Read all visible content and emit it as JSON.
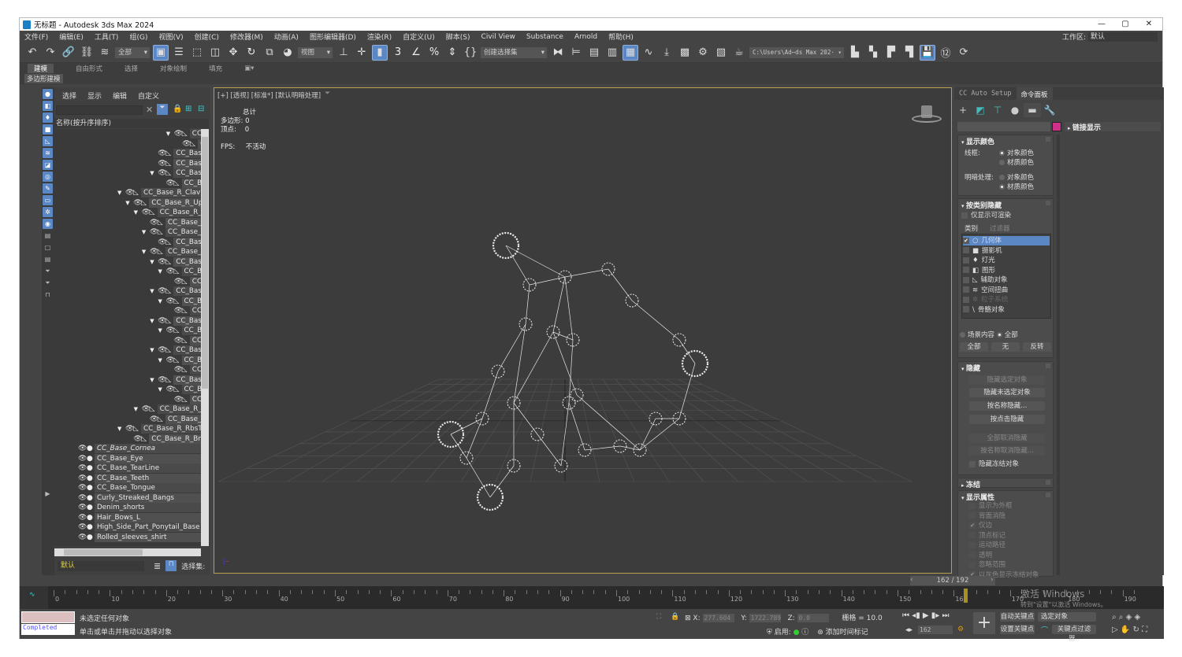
{
  "window": {
    "title": "无标题 - Autodesk 3ds Max 2024",
    "controls": [
      "—",
      "▢",
      "✕"
    ]
  },
  "menu": [
    "文件(F)",
    "编辑(E)",
    "工具(T)",
    "组(G)",
    "视图(V)",
    "创建(C)",
    "修改器(M)",
    "动画(A)",
    "图形编辑器(D)",
    "渲染(R)",
    "自定义(U)",
    "脚本(S)",
    "Civil View",
    "Substance",
    "Arnold",
    "帮助(H)"
  ],
  "workspace": {
    "label": "工作区:",
    "value": "默认"
  },
  "toolbar": {
    "selection_filter": "全部",
    "ref_coord": "视图",
    "named_sel": "创建选择集",
    "project_path": "C:\\Users\\Ad⋯ds Max 202·",
    "icons": [
      "undo-icon",
      "redo-icon",
      "link-icon",
      "unlink-icon",
      "bind-spacewarp-icon",
      "SEL1",
      "select-object-icon",
      "select-by-name-icon",
      "rect-select-icon",
      "window-crossing-icon",
      "move-icon",
      "rotate-icon",
      "scale-icon",
      "placement-icon",
      "SEL2",
      "use-pivot-icon",
      "select-manipulate-icon",
      "keyboard-shortcut-icon",
      "snap-3d-icon",
      "angle-snap-icon",
      "percent-snap-icon",
      "spinner-snap-icon",
      "edit-named-sel-icon",
      "SEL3",
      "mirror-icon",
      "align-icon",
      "toggle-scene-explorer-icon",
      "toggle-layer-explorer-icon",
      "ribbon-icon",
      "curve-editor-icon",
      "dope-sheet-icon",
      "material-editor-icon",
      "render-setup-icon",
      "rendered-frame-icon",
      "render-icon",
      "PATH",
      "project-folder-icon",
      "open-project-icon",
      "new-project-icon",
      "set-project-icon",
      "save-icon",
      "twelve-icon",
      "history-icon"
    ],
    "glyphs": {
      "undo-icon": "↶",
      "redo-icon": "↷",
      "link-icon": "🔗",
      "unlink-icon": "⛓",
      "bind-spacewarp-icon": "≋",
      "select-object-icon": "▣",
      "select-by-name-icon": "☰",
      "rect-select-icon": "⬚",
      "window-crossing-icon": "◫",
      "move-icon": "✥",
      "rotate-icon": "↻",
      "scale-icon": "⧉",
      "placement-icon": "◕",
      "use-pivot-icon": "⊥",
      "select-manipulate-icon": "✛",
      "keyboard-shortcut-icon": "▮",
      "snap-3d-icon": "3",
      "angle-snap-icon": "∠",
      "percent-snap-icon": "%",
      "spinner-snap-icon": "⇕",
      "edit-named-sel-icon": "{}",
      "mirror-icon": "⧓",
      "align-icon": "⊨",
      "toggle-scene-explorer-icon": "▤",
      "toggle-layer-explorer-icon": "▥",
      "ribbon-icon": "▦",
      "curve-editor-icon": "∿",
      "dope-sheet-icon": "⤓",
      "material-editor-icon": "▩",
      "render-setup-icon": "⚙",
      "rendered-frame-icon": "▧",
      "render-icon": "☕",
      "project-folder-icon": "▙",
      "open-project-icon": "▚",
      "new-project-icon": "▛",
      "set-project-icon": "▜",
      "save-icon": "💾",
      "twelve-icon": "⑫",
      "history-icon": "⟳"
    },
    "active": [
      "select-object-icon",
      "keyboard-shortcut-icon",
      "ribbon-icon",
      "save-icon"
    ]
  },
  "ribbon": {
    "tabs": [
      "建模",
      "自由形式",
      "选择",
      "对象绘制",
      "填充"
    ],
    "active": "建模",
    "sub": "多边形建模"
  },
  "explorer": {
    "menu": [
      "选择",
      "显示",
      "编辑",
      "自定义"
    ],
    "header": "名称(按升序排序)",
    "bones": [
      {
        "name": "CC_Base_",
        "depth": 8,
        "expanded": true
      },
      {
        "name": "CC_Bas",
        "depth": 9
      },
      {
        "name": "CC_Base_L_Eye",
        "depth": 6
      },
      {
        "name": "CC_Base_R_Eye",
        "depth": 6
      },
      {
        "name": "CC_Base_Uppe",
        "depth": 6,
        "expanded": true
      },
      {
        "name": "CC_Base_Te",
        "depth": 7
      },
      {
        "name": "CC_Base_R_Clavicle",
        "depth": 2,
        "expanded": true
      },
      {
        "name": "CC_Base_R_Upperarm",
        "depth": 3,
        "expanded": true
      },
      {
        "name": "CC_Base_R_Forearm",
        "depth": 4,
        "expanded": true
      },
      {
        "name": "CC_Base_R_Elbow",
        "depth": 5
      },
      {
        "name": "CC_Base_R_Forea",
        "depth": 5,
        "expanded": true
      },
      {
        "name": "CC_Base_R_Fo",
        "depth": 6
      },
      {
        "name": "CC_Base_R_Hand",
        "depth": 5,
        "expanded": true
      },
      {
        "name": "CC_Base_R_Ind",
        "depth": 6,
        "expanded": true
      },
      {
        "name": "CC_Base_R_",
        "depth": 7,
        "expanded": true
      },
      {
        "name": "CC_Base_",
        "depth": 8
      },
      {
        "name": "CC_Base_R_Mid",
        "depth": 6,
        "expanded": true
      },
      {
        "name": "CC_Base_R_",
        "depth": 7,
        "expanded": true
      },
      {
        "name": "CC_Base_",
        "depth": 8
      },
      {
        "name": "CC_Base_R_Pin",
        "depth": 6,
        "expanded": true
      },
      {
        "name": "CC_Base_R_",
        "depth": 7,
        "expanded": true
      },
      {
        "name": "CC_Base_",
        "depth": 8
      },
      {
        "name": "CC_Base_R_Rin",
        "depth": 6,
        "expanded": true
      },
      {
        "name": "CC_Base_R_",
        "depth": 7,
        "expanded": true
      },
      {
        "name": "CC_Base_",
        "depth": 8
      },
      {
        "name": "CC_Base_R_Th",
        "depth": 6,
        "expanded": true
      },
      {
        "name": "CC_Base_R_",
        "depth": 7,
        "expanded": true
      },
      {
        "name": "CC_Base_",
        "depth": 8
      },
      {
        "name": "CC_Base_R_Upperarm",
        "depth": 4,
        "expanded": true
      },
      {
        "name": "CC_Base_R_Upper",
        "depth": 5
      },
      {
        "name": "CC_Base_R_RbsTwist",
        "depth": 2,
        "expanded": true
      },
      {
        "name": "CC_Base_R_Breast",
        "depth": 3
      }
    ],
    "meshes": [
      {
        "name": "CC_Base_Cornea",
        "italic": true
      },
      {
        "name": "CC_Base_Eye"
      },
      {
        "name": "CC_Base_TearLine"
      },
      {
        "name": "CC_Base_Teeth"
      },
      {
        "name": "CC_Base_Tongue"
      },
      {
        "name": "Curly_Streaked_Bangs"
      },
      {
        "name": "Denim_shorts"
      },
      {
        "name": "Hair_Bows_L"
      },
      {
        "name": "High_Side_Part_Ponytail_Base"
      },
      {
        "name": "Rolled_sleeves_shirt"
      }
    ],
    "layer": "默认",
    "selection_set_label": "选择集:"
  },
  "viewport": {
    "labels": "[+] [透视] [标准*] [默认明暗处理]",
    "stats": {
      "total": "总计",
      "polys_label": "多边形:",
      "polys": "0",
      "verts_label": "顶点:",
      "verts": "0",
      "fps_label": "FPS:",
      "fps": "不活动"
    }
  },
  "command_panel": {
    "tabs": [
      "CC Auto Setup",
      "命令面板"
    ],
    "active_tab": "命令面板",
    "color": "#d0308a",
    "link_display": "链接显示",
    "display_color": {
      "title": "显示颜色",
      "wire_label": "线框:",
      "shaded_label": "明暗处理:",
      "opt1": "对象颜色",
      "opt2": "材质颜色"
    },
    "hide_by_category": {
      "title": "按类别隐藏",
      "renderable_only": "仅显示可渲染",
      "tabs": [
        "类别",
        "过滤器"
      ],
      "items": [
        {
          "label": "几何体",
          "checked": true,
          "selected": true
        },
        {
          "label": "摄影机"
        },
        {
          "label": "灯光"
        },
        {
          "label": "图形"
        },
        {
          "label": "辅助对象"
        },
        {
          "label": "空间扭曲"
        },
        {
          "label": "粒子系统",
          "disabled": true
        },
        {
          "label": "骨骼对象"
        }
      ],
      "scene_content": "场景内容",
      "all_radio": "全部",
      "buttons": [
        "全部",
        "无",
        "反转"
      ]
    },
    "hide": {
      "title": "隐藏",
      "buttons": [
        {
          "label": "隐藏选定对象",
          "disabled": true
        },
        {
          "label": "隐藏未选定对象"
        },
        {
          "label": "按名称隐藏..."
        },
        {
          "label": "按点击隐藏"
        },
        {
          "label": "全部取消隐藏",
          "disabled": true
        },
        {
          "label": "按名称取消隐藏...",
          "disabled": true
        }
      ],
      "hide_frozen": "隐藏冻结对象"
    },
    "freeze": {
      "title": "冻结"
    },
    "display_props": {
      "title": "显示属性",
      "items": [
        {
          "label": "显示为外框"
        },
        {
          "label": "背面消隐"
        },
        {
          "label": "仅边",
          "checked": true
        },
        {
          "label": "顶点标记"
        },
        {
          "label": "运动路径"
        },
        {
          "label": "透明"
        },
        {
          "label": "忽略范围"
        },
        {
          "label": "以灰色显示冻结对象",
          "checked": true
        }
      ]
    }
  },
  "timeline": {
    "current": 162,
    "end": 192,
    "slider_text": "162 / 192",
    "ticks": [
      0,
      10,
      20,
      30,
      40,
      50,
      60,
      70,
      80,
      90,
      100,
      110,
      120,
      130,
      140,
      150,
      160,
      170,
      180,
      190
    ]
  },
  "status": {
    "maxscript_out": "Completed",
    "line1": "未选定任何对象",
    "line2": "单击或单击并拖动以选择对象",
    "x_label": "X:",
    "x": "277.604",
    "y_label": "Y:",
    "y": "1722.789",
    "z_label": "Z:",
    "z": "0.0",
    "grid": "栅格 = 10.0",
    "enable_label": "启用:",
    "add_time_tag": "添加时间标记",
    "frame": "162",
    "auto_key": "自动关键点",
    "set_key": "设置关键点",
    "key_mode": "选定对象",
    "key_filters": "关键点过滤器..",
    "watermark1": "激活 Windows",
    "watermark2": "转到\"设置\"以激活 Windows。"
  }
}
